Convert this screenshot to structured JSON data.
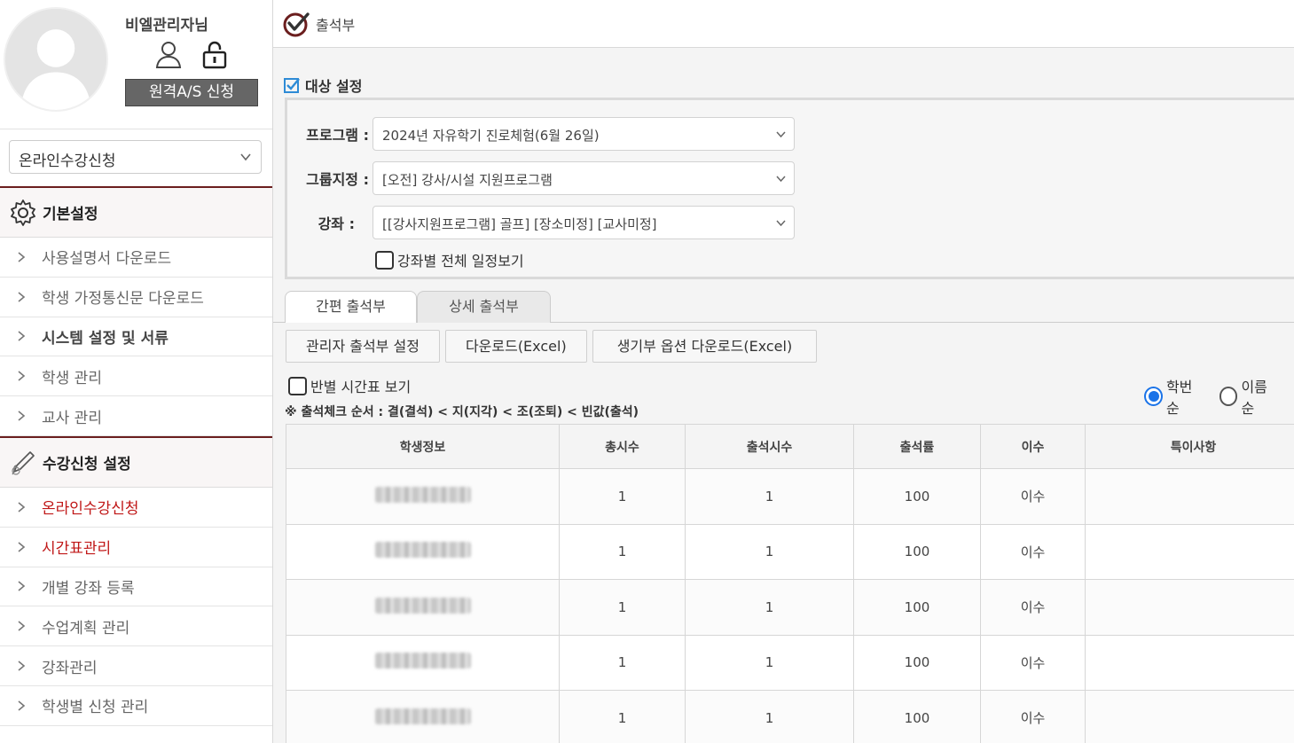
{
  "profile": {
    "user_name": "비엘관리자님",
    "as_button": "원격A/S 신청",
    "icons": [
      "user-icon",
      "unlock-icon"
    ]
  },
  "sidebar": {
    "select_value": "온라인수강신청",
    "sections": [
      {
        "title": "기본설정",
        "icon": "gear-icon",
        "items": [
          {
            "label": "사용설명서 다운로드",
            "style": "normal"
          },
          {
            "label": "학생 가정통신문 다운로드",
            "style": "normal"
          },
          {
            "label": "시스템 설정 및 서류",
            "style": "bold"
          },
          {
            "label": "학생 관리",
            "style": "normal"
          },
          {
            "label": "교사 관리",
            "style": "normal"
          }
        ]
      },
      {
        "title": "수강신청 설정",
        "icon": "pencil-icon",
        "items": [
          {
            "label": "온라인수강신청",
            "style": "red"
          },
          {
            "label": "시간표관리",
            "style": "red"
          },
          {
            "label": "개별 강좌 등록",
            "style": "normal"
          },
          {
            "label": "수업계획 관리",
            "style": "normal"
          },
          {
            "label": "강좌관리",
            "style": "normal"
          },
          {
            "label": "학생별 신청 관리",
            "style": "normal"
          }
        ]
      }
    ]
  },
  "header": {
    "title": "출석부",
    "icon": "check-circle-icon"
  },
  "target": {
    "heading": "대상 설정",
    "program_label": "프로그램 :",
    "program_value": "2024년 자유학기 진로체험(6월 26일)",
    "group_label": "그룹지정 :",
    "group_value": "[오전] 강사/시설 지원프로그램",
    "course_label": "강좌 :",
    "course_value": "[[강사지원프로그램] 골프] [장소미정] [교사미정]",
    "schedule_checkbox": "강좌별 전체 일정보기"
  },
  "tabs": [
    {
      "label": "간편 출석부",
      "active": true
    },
    {
      "label": "상세 출석부",
      "active": false
    }
  ],
  "buttons": {
    "admin_setting": "관리자 출석부 설정",
    "download_excel": "다운로드(Excel)",
    "record_download": "생기부 옵션 다운로드(Excel)"
  },
  "options": {
    "class_timetable": "반별 시간표 보기",
    "sort_by_number": "학번순",
    "sort_by_name": "이름순",
    "selected_sort": "학번순"
  },
  "note": "※ 출석체크 순서 : 결(결석) < 지(지각) < 조(조퇴) < 빈값(출석)",
  "table": {
    "headers": [
      "학생정보",
      "총시수",
      "출석시수",
      "출석률",
      "이수",
      "특이사항"
    ],
    "rows": [
      {
        "total": "1",
        "attended": "1",
        "rate": "100",
        "status": "이수",
        "remark": ""
      },
      {
        "total": "1",
        "attended": "1",
        "rate": "100",
        "status": "이수",
        "remark": ""
      },
      {
        "total": "1",
        "attended": "1",
        "rate": "100",
        "status": "이수",
        "remark": ""
      },
      {
        "total": "1",
        "attended": "1",
        "rate": "100",
        "status": "이수",
        "remark": ""
      },
      {
        "total": "1",
        "attended": "1",
        "rate": "100",
        "status": "이수",
        "remark": ""
      }
    ]
  },
  "colors": {
    "brand_dark_red": "#6b1e1e",
    "menu_red": "#c01818",
    "radio_blue": "#1a73e8",
    "checkbox_blue": "#2e8bd6"
  }
}
